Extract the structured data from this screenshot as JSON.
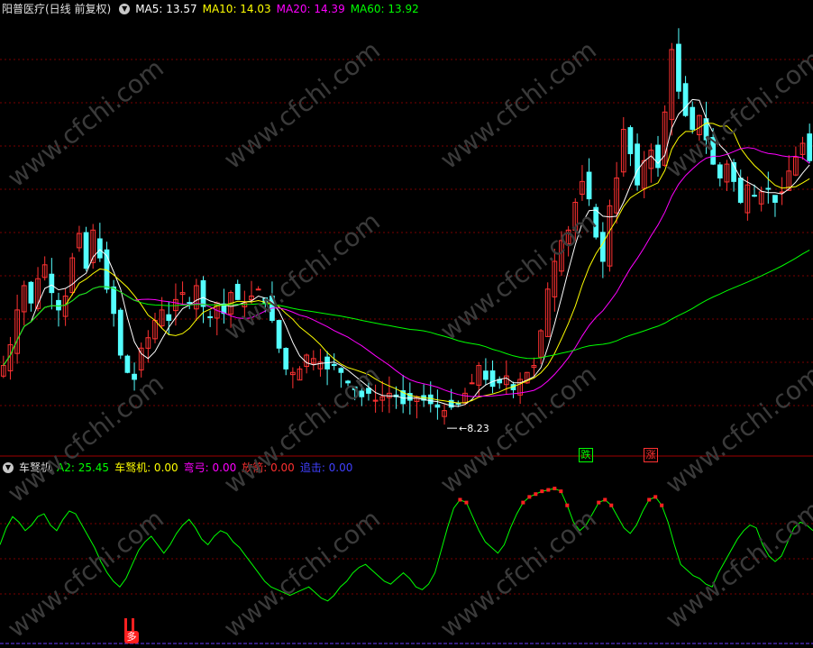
{
  "main_header": {
    "title": "阳普医疗(日线 前复权)",
    "ma": [
      {
        "label": "MA5: 13.57",
        "color": "#ffffff"
      },
      {
        "label": "MA10: 14.03",
        "color": "#ffff00"
      },
      {
        "label": "MA20: 14.39",
        "color": "#ff00ff"
      },
      {
        "label": "MA60: 13.92",
        "color": "#00ff00"
      }
    ]
  },
  "indicator_header": {
    "title": "车驽机",
    "items": [
      {
        "label": "A2: 25.45",
        "color": "#00ff00"
      },
      {
        "label": "车驽机: 0.00",
        "color": "#ffff00"
      },
      {
        "label": "弯弓: 0.00",
        "color": "#ff00ff"
      },
      {
        "label": "放箭: 0.00",
        "color": "#ff3030"
      },
      {
        "label": "追击: 0.00",
        "color": "#4040ff"
      }
    ]
  },
  "annotations": {
    "low_label": "8.23",
    "badge_down": "跌",
    "badge_up": "涨",
    "badge_buy": "多"
  },
  "watermark": "www.cfchi.com",
  "colors": {
    "up": "#ff3232",
    "down": "#54ffff",
    "grid": "#7a0000",
    "divider": "#a00000"
  },
  "chart_data": {
    "type": "candlestick",
    "price_range": [
      7.4,
      19.6
    ],
    "closes": [
      9.8,
      10.4,
      11.4,
      12.1,
      11.6,
      12.3,
      12.7,
      11.9,
      11.4,
      11.8,
      12.9,
      13.6,
      12.6,
      13.7,
      12.9,
      12.0,
      11.3,
      10.1,
      9.6,
      9.4,
      10.3,
      10.6,
      11.1,
      11.4,
      11.1,
      11.7,
      11.9,
      11.6,
      12.1,
      11.5,
      11.2,
      11.6,
      11.3,
      11.9,
      11.7,
      11.6,
      11.8,
      12.0,
      11.6,
      11.1,
      10.3,
      9.7,
      9.6,
      9.7,
      10.1,
      10.0,
      9.9,
      9.7,
      9.8,
      9.6,
      9.3,
      9.1,
      8.9,
      9.0,
      8.8,
      8.9,
      9.0,
      8.9,
      8.7,
      8.8,
      8.9,
      8.8,
      8.7,
      8.6,
      8.5,
      8.6,
      8.7,
      9.0,
      9.3,
      9.8,
      9.4,
      9.2,
      9.3,
      9.5,
      9.1,
      9.4,
      9.6,
      9.8,
      10.8,
      12.0,
      12.8,
      13.4,
      13.7,
      14.5,
      15.1,
      14.6,
      13.5,
      12.8,
      14.4,
      15.2,
      16.6,
      15.9,
      15.0,
      15.7,
      16.0,
      15.5,
      17.1,
      18.9,
      17.7,
      17.0,
      16.6,
      17.0,
      16.3,
      15.6,
      15.2,
      15.6,
      15.1,
      14.5,
      15.0,
      14.7,
      14.8,
      14.9,
      14.5,
      14.8,
      15.4,
      15.8,
      16.2,
      15.7
    ],
    "ma": {
      "MA5": 13.57,
      "MA10": 14.03,
      "MA20": 14.39,
      "MA60": 13.92
    },
    "indicator": {
      "name": "A2",
      "range": [
        0,
        100
      ],
      "values": [
        60,
        72,
        80,
        76,
        70,
        74,
        80,
        82,
        74,
        70,
        78,
        84,
        82,
        74,
        66,
        58,
        48,
        40,
        34,
        30,
        36,
        46,
        56,
        62,
        66,
        60,
        54,
        60,
        68,
        74,
        78,
        72,
        64,
        60,
        66,
        70,
        68,
        62,
        58,
        52,
        46,
        40,
        34,
        30,
        28,
        26,
        24,
        26,
        28,
        30,
        26,
        22,
        20,
        24,
        30,
        34,
        40,
        44,
        46,
        42,
        38,
        34,
        32,
        36,
        40,
        36,
        30,
        28,
        32,
        40,
        56,
        72,
        86,
        92,
        90,
        80,
        70,
        62,
        58,
        54,
        60,
        72,
        82,
        90,
        94,
        96,
        98,
        99,
        100,
        98,
        88,
        76,
        70,
        74,
        82,
        90,
        92,
        88,
        80,
        72,
        68,
        74,
        84,
        92,
        94,
        88,
        76,
        60,
        46,
        42,
        38,
        36,
        32,
        30,
        40,
        48,
        56,
        64,
        70,
        74,
        72,
        60,
        52,
        48,
        52,
        62,
        72,
        76,
        74,
        70
      ]
    }
  }
}
